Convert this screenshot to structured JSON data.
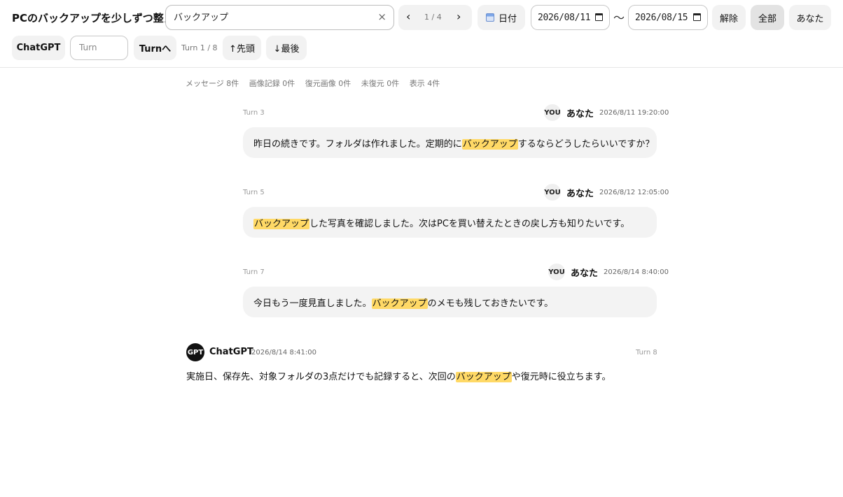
{
  "toolbar": {
    "title": "PCのバックアップを少しずつ整える",
    "search_value": "バックアップ",
    "clear_icon": "×",
    "prev_icon": "‹",
    "next_icon": "›",
    "match_count": "1 / 4",
    "date_label": "日付",
    "date_from": "2026/08/11",
    "date_sep": "〜",
    "date_to": "2026/08/15",
    "reset_label": "解除",
    "filter_all_label": "全部",
    "filter_you_label": "あなた",
    "filter_chatgpt_label": "ChatGPT",
    "turn_placeholder": "Turn",
    "turn_jump_label": "Turnへ",
    "turn_position": "Turn 1 / 8",
    "first_label": "↑先頭",
    "last_label": "↓最後"
  },
  "stats": {
    "messages": "メッセージ 8件",
    "image_records": "画像記録 0件",
    "restored_images": "復元画像 0件",
    "unrestored": "未復元 0件",
    "shown": "表示 4件"
  },
  "messages": [
    {
      "turn": "Turn 3",
      "avatar": "YOU",
      "author": "あなた",
      "time": "2026/8/11 19:20:00",
      "text_before": "昨日の続きです。フォルダは作れました。定期的に",
      "highlight": "バックアップ",
      "text_after": "するならどうしたらいいですか？"
    },
    {
      "turn": "Turn 5",
      "avatar": "YOU",
      "author": "あなた",
      "time": "2026/8/12 12:05:00",
      "text_before": "",
      "highlight": "バックアップ",
      "text_after": "した写真を確認しました。次はPCを買い替えたときの戻し方も知りたいです。"
    },
    {
      "turn": "Turn 7",
      "avatar": "YOU",
      "author": "あなた",
      "time": "2026/8/14 8:40:00",
      "text_before": "今日もう一度見直しました。",
      "highlight": "バックアップ",
      "text_after": "のメモも残しておきたいです。"
    }
  ],
  "assistant": {
    "avatar": "GPT",
    "author": "ChatGPT",
    "time": "2026/8/14 8:41:00",
    "turn": "Turn 8",
    "text_before": "実施日、保存先、対象フォルダの3点だけでも記録すると、次回の",
    "highlight": "バックアップ",
    "text_after": "や復元時に役立ちます。"
  },
  "colors": {
    "highlight": "#ffd966",
    "bubble": "#f3f3f3",
    "pill": "#f2f2f2",
    "active_pill": "#e3e3e3"
  }
}
